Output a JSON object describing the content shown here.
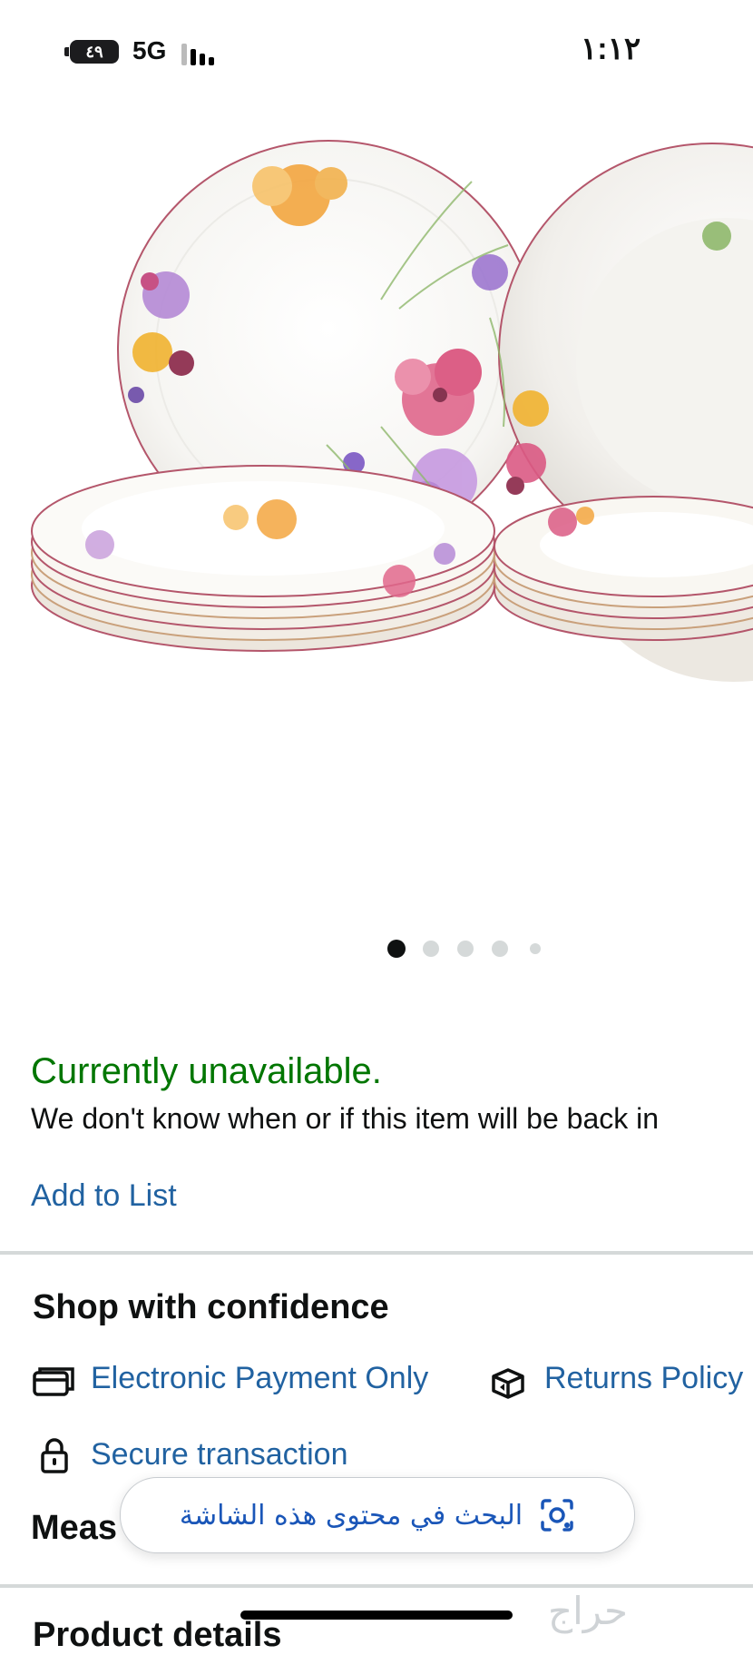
{
  "status_bar": {
    "battery": "٤٩",
    "network": "5G",
    "time": "١:١٢"
  },
  "gallery": {
    "image_alt": "Floral porcelain dinnerware set",
    "page_count": 5,
    "active_page": 1
  },
  "availability": {
    "status": "Currently unavailable.",
    "note": "We don't know when or if this item will be back in"
  },
  "actions": {
    "add_to_list": "Add to List"
  },
  "confidence": {
    "title": "Shop with confidence",
    "items": [
      {
        "label": "Electronic Payment Only",
        "icon": "card-icon"
      },
      {
        "label": "Returns Policy",
        "icon": "box-return-icon"
      },
      {
        "label": "Secure transaction",
        "icon": "lock-icon"
      }
    ]
  },
  "sections": {
    "measurements_partial": "Meas",
    "product_details": "Product details"
  },
  "screen_search": {
    "label": "البحث في محتوى هذه الشاشة",
    "icon": "lens-icon"
  },
  "watermark": "حراج",
  "colors": {
    "available_green": "#007600",
    "link_blue": "#2162a1",
    "divider": "#d5d9d9"
  }
}
